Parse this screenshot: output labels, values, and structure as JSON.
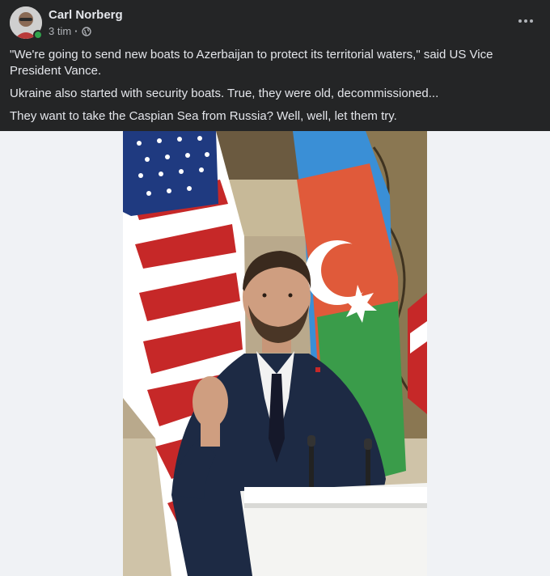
{
  "post": {
    "author": "Carl Norberg",
    "time": "3 tim",
    "separator": "·",
    "paragraphs": [
      "\"We're going to send new boats to Azerbaijan to protect its territorial waters,\" said US Vice President Vance.",
      "Ukraine also started with security boats. True, they were old, decommissioned...",
      "They want to take the Caspian Sea from Russia? Well, well, let them try."
    ],
    "audience_icon": "globe-icon",
    "more_icon": "more-horizontal-icon"
  },
  "colors": {
    "header_bg": "#242526",
    "text": "#e4e6eb",
    "meta_text": "#b0b3b8",
    "page_bg": "#f0f2f5",
    "online": "#31a24c"
  }
}
